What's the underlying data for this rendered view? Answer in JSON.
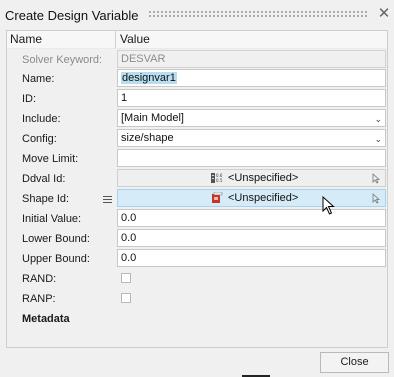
{
  "window": {
    "title": "Create Design Variable",
    "close_glyph": "✕"
  },
  "columns": {
    "name": "Name",
    "value": "Value"
  },
  "rows": [
    {
      "label": "Solver Keyword:",
      "value": "DESVAR"
    },
    {
      "label": "Name:",
      "value": "designvar1"
    },
    {
      "label": "ID:",
      "value": "1"
    },
    {
      "label": "Include:",
      "value": "[Main Model]"
    },
    {
      "label": "Config:",
      "value": "size/shape"
    },
    {
      "label": "Move Limit:",
      "value": ""
    },
    {
      "label": "Ddval Id:",
      "value": "<Unspecified>"
    },
    {
      "label": "Shape Id:",
      "value": "<Unspecified>"
    },
    {
      "label": "Initial Value:",
      "value": "0.0"
    },
    {
      "label": "Lower Bound:",
      "value": "0.0"
    },
    {
      "label": "Upper Bound:",
      "value": "0.0"
    },
    {
      "label": "RAND:",
      "checked": false
    },
    {
      "label": "RANP:",
      "checked": false
    },
    {
      "label": "Metadata"
    }
  ],
  "icons": {
    "ddval": "ddval-entity-icon",
    "shape": "shape-entity-icon",
    "select_arrow": "cursor-arrow-icon",
    "menu": "menu-lines-icon",
    "dropdown": "chevron-down-icon"
  },
  "buttons": {
    "close": "Close"
  },
  "colors": {
    "highlight": "#d5ecf8",
    "selection": "#b8dcf0",
    "disabled_text": "#8a8a8a"
  }
}
